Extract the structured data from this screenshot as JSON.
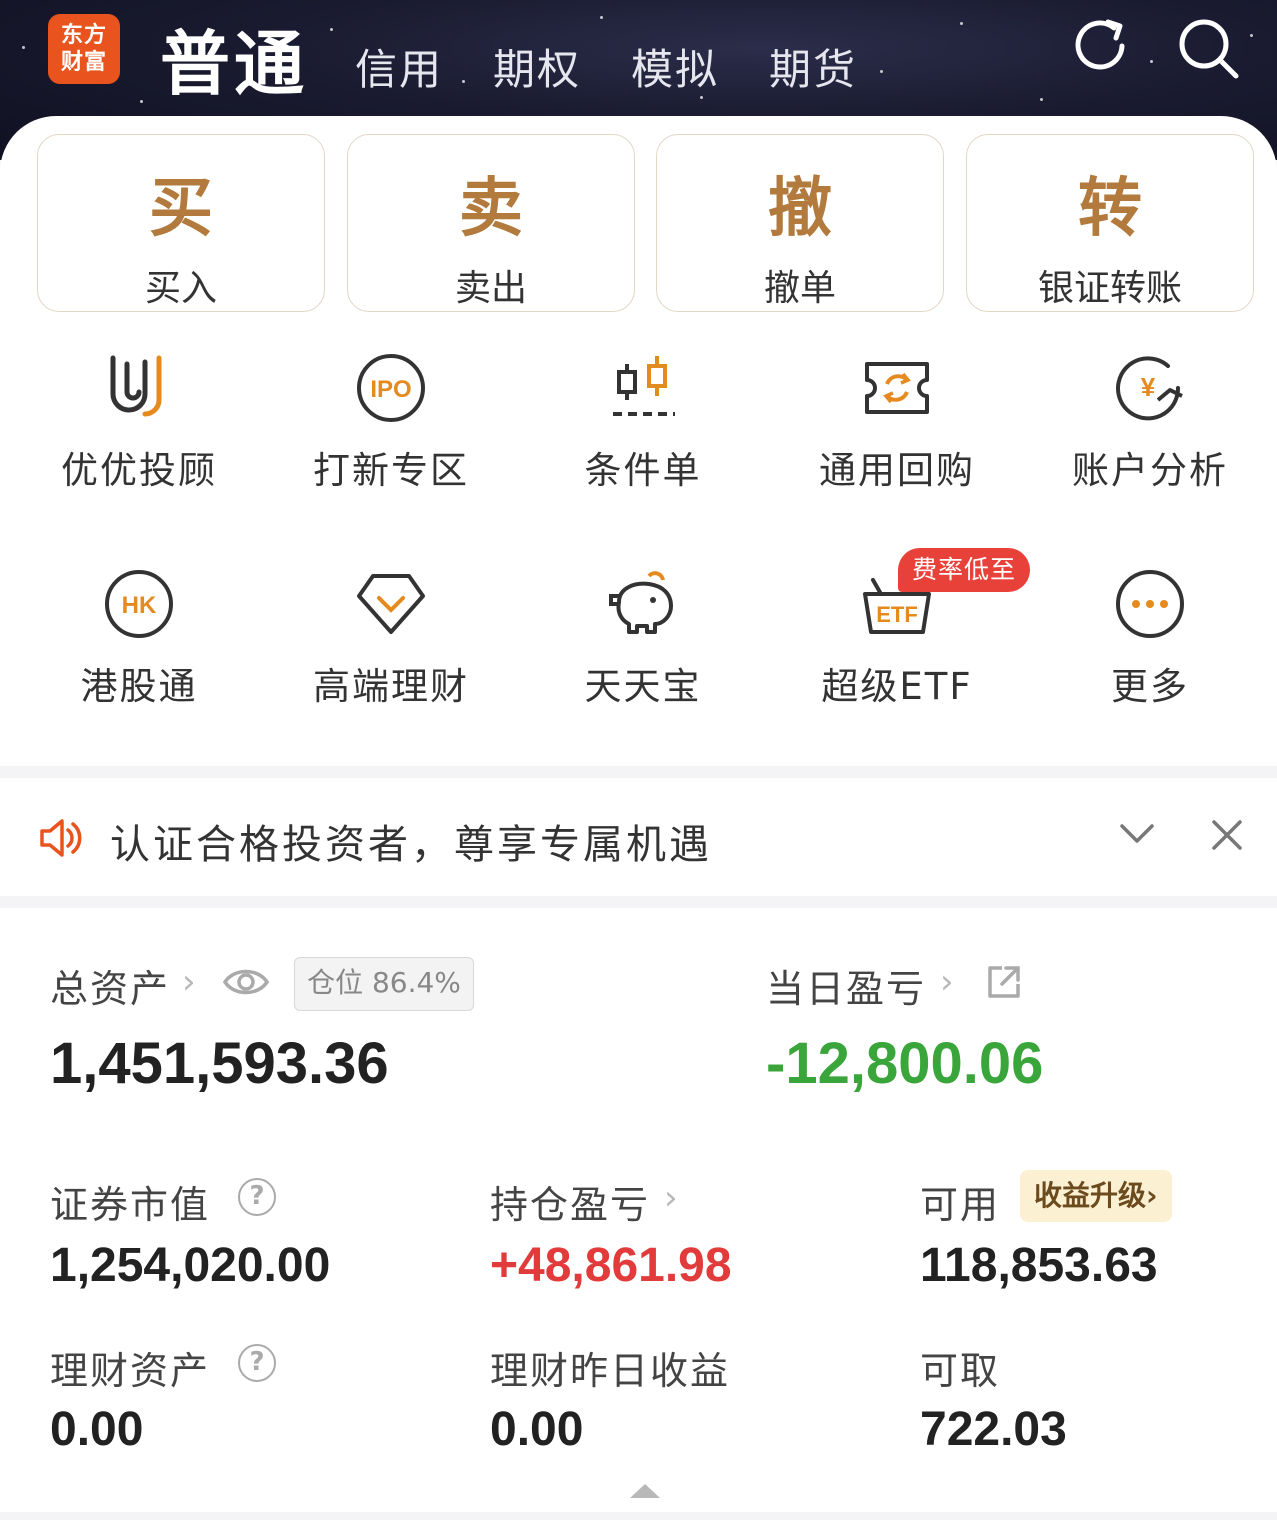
{
  "brand": {
    "logo_line1": "东方",
    "logo_line2": "财富"
  },
  "account_tabs": [
    {
      "label": "普通",
      "active": true
    },
    {
      "label": "信用",
      "active": false
    },
    {
      "label": "期权",
      "active": false
    },
    {
      "label": "模拟",
      "active": false
    },
    {
      "label": "期货",
      "active": false
    }
  ],
  "header_icons": [
    "refresh-icon",
    "search-icon"
  ],
  "quick_actions": [
    {
      "glyph": "买",
      "label": "买入"
    },
    {
      "glyph": "卖",
      "label": "卖出"
    },
    {
      "glyph": "撤",
      "label": "撤单"
    },
    {
      "glyph": "转",
      "label": "银证转账"
    }
  ],
  "features_row1": [
    {
      "icon": "youyou-advisor-icon",
      "label": "优优投顾"
    },
    {
      "icon": "ipo-icon",
      "label": "打新专区",
      "icon_text": "IPO"
    },
    {
      "icon": "candlestick-condition-icon",
      "label": "条件单"
    },
    {
      "icon": "repurchase-icon",
      "label": "通用回购"
    },
    {
      "icon": "account-analysis-icon",
      "label": "账户分析",
      "icon_text": "¥"
    }
  ],
  "features_row2": [
    {
      "icon": "hk-icon",
      "label": "港股通",
      "icon_text": "HK"
    },
    {
      "icon": "diamond-icon",
      "label": "高端理财"
    },
    {
      "icon": "piggy-bank-icon",
      "label": "天天宝"
    },
    {
      "icon": "etf-basket-icon",
      "label": "超级ETF",
      "icon_text": "ETF",
      "badge": "费率低至"
    },
    {
      "icon": "more-icon",
      "label": "更多"
    }
  ],
  "notice": {
    "text": "认证合格投资者，尊享专属机遇"
  },
  "assets": {
    "total_label": "总资产",
    "position_badge": "仓位 86.4%",
    "total_value": "1,451,593.36",
    "daily_pl_label": "当日盈亏",
    "daily_pl_value": "-12,800.06",
    "market_value_label": "证券市值",
    "market_value": "1,254,020.00",
    "holding_pl_label": "持仓盈亏",
    "holding_pl_value": "+48,861.98",
    "available_label": "可用",
    "earn_upgrade_badge": "收益升级›",
    "available_value": "118,853.63",
    "wealth_label": "理财资产",
    "wealth_value": "0.00",
    "wealth_yesterday_label": "理财昨日收益",
    "wealth_yesterday_value": "0.00",
    "withdrawable_label": "可取",
    "withdrawable_value": "722.03"
  },
  "colors": {
    "brand_orange": "#e8531e",
    "gold": "#b27a3c",
    "icon_orange": "#e58a1f",
    "gain_red": "#e23b3b",
    "loss_green": "#3aa53a",
    "header_dark": "#1a1b30"
  }
}
